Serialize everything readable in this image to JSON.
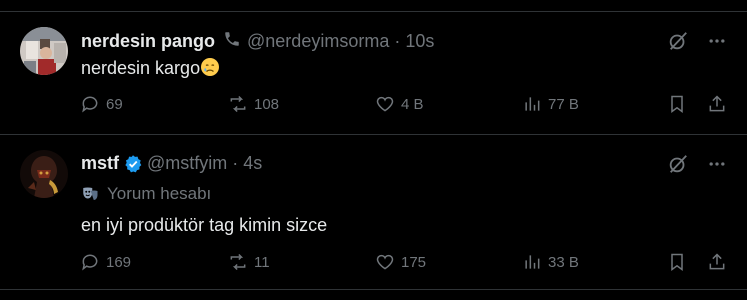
{
  "tweets": [
    {
      "display_name": "nerdesin pango",
      "handle": "@nerdeyimsorma",
      "time": "10s",
      "text": "nerdesin kargo",
      "emoji": "crying-face",
      "replies": "69",
      "reposts": "108",
      "likes": "4 B",
      "views": "77 B"
    },
    {
      "display_name": "mstf",
      "handle": "@mstfyim",
      "time": "4s",
      "subtitle": "Yorum hesabı",
      "text": "en iyi prodüktör tag kimin sizce",
      "replies": "169",
      "reposts": "11",
      "likes": "175",
      "views": "33 B"
    }
  ],
  "separator_dot": "·",
  "colors": {
    "background": "#000000",
    "text": "#e7e9ea",
    "muted": "#71767b",
    "separator": "#2f3336",
    "verified": "#1d9bf0"
  },
  "icons": [
    "phone-icon",
    "verified-badge-icon",
    "grok-icon",
    "more-icon",
    "reply-icon",
    "repost-icon",
    "like-icon",
    "views-icon",
    "bookmark-icon",
    "share-icon",
    "comedy-mask-icon"
  ]
}
